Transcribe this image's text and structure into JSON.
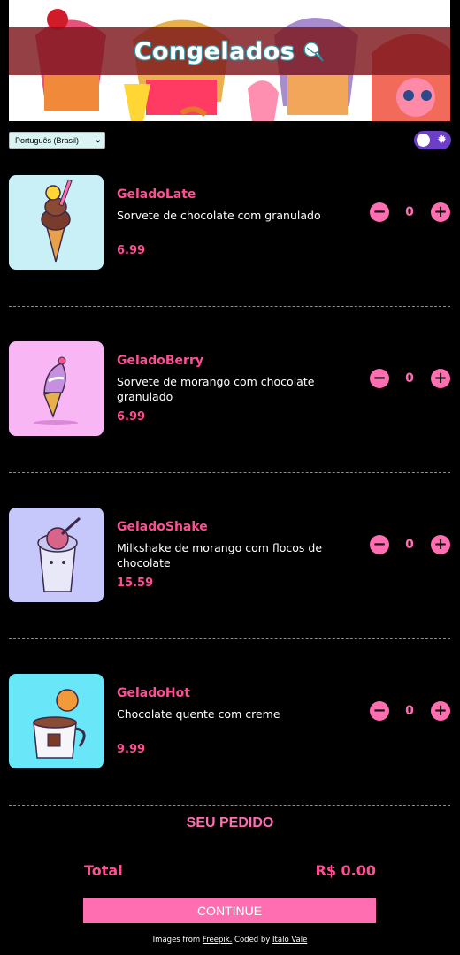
{
  "header": {
    "title": "Congelados",
    "logo_icon": "ice-cream-icon"
  },
  "controls": {
    "language_selected": "Português (Brasil)",
    "theme_toggle_icon": "sun-icon"
  },
  "products": [
    {
      "name": "GeladoLate",
      "description": "Sorvete de chocolate com granulado",
      "price": "6.99",
      "quantity": "0",
      "thumb_bg": "#c9f0f6"
    },
    {
      "name": "GeladoBerry",
      "description": "Sorvete de morango com chocolate granulado",
      "price": "6.99",
      "quantity": "0",
      "thumb_bg": "#f9b6f5"
    },
    {
      "name": "GeladoShake",
      "description": "Milkshake de morango com flocos de chocolate",
      "price": "15.59",
      "quantity": "0",
      "thumb_bg": "#c6c7fb"
    },
    {
      "name": "GeladoHot",
      "description": "Chocolate quente com creme",
      "price": "9.99",
      "quantity": "0",
      "thumb_bg": "#69e6f8"
    }
  ],
  "order": {
    "title": "SEU PEDIDO",
    "total_label": "Total",
    "total_value": "R$ 0.00",
    "continue_label": "CONTINUE"
  },
  "footer": {
    "images_from": "Images from",
    "freepik_link": "Freepik.",
    "coded_by": "Coded by",
    "author_link": "Italo Vale"
  },
  "colors": {
    "accent_pink": "#ff4f93",
    "button_pink": "#ff6eb0",
    "toggle_purple": "#6b3fc7",
    "banner_strip": "#7d161c"
  }
}
